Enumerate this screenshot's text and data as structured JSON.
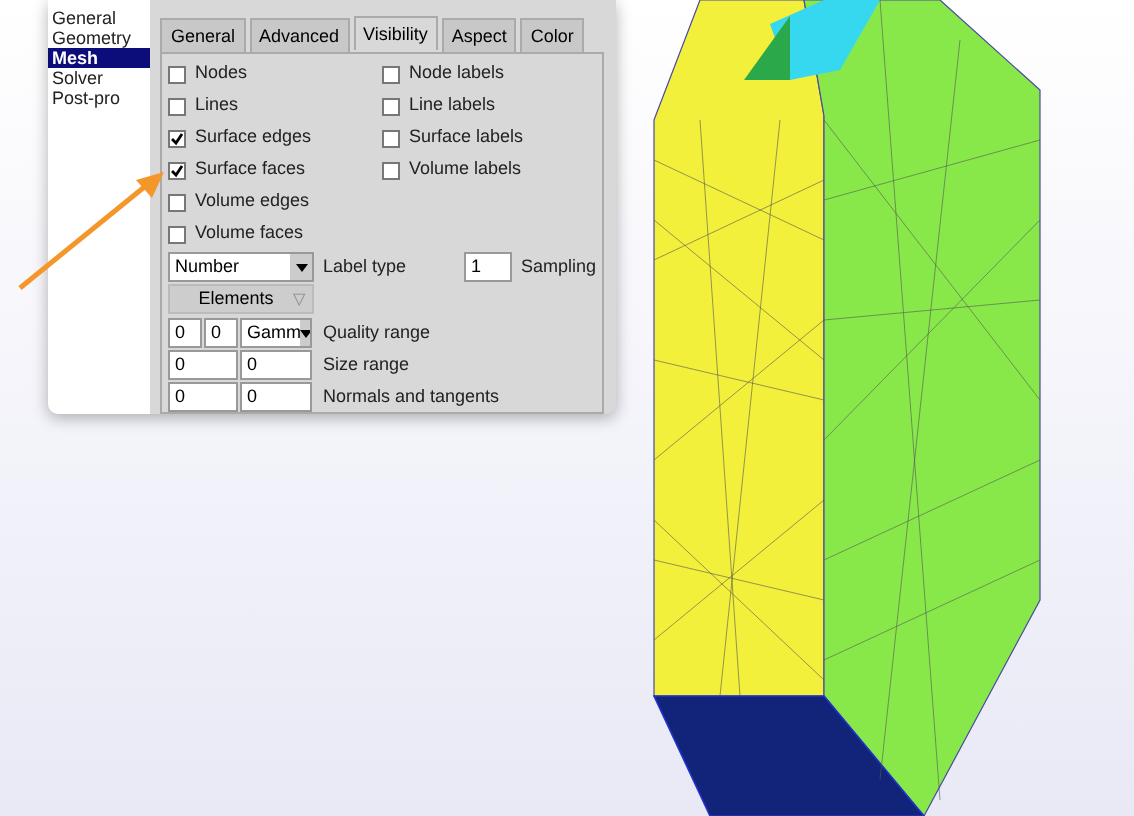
{
  "sidebar": {
    "items": [
      {
        "label": "General",
        "selected": false
      },
      {
        "label": "Geometry",
        "selected": false
      },
      {
        "label": "Mesh",
        "selected": true
      },
      {
        "label": "Solver",
        "selected": false
      },
      {
        "label": "Post-pro",
        "selected": false
      }
    ]
  },
  "tabs": [
    {
      "label": "General",
      "selected": false
    },
    {
      "label": "Advanced",
      "selected": false
    },
    {
      "label": "Visibility",
      "selected": true
    },
    {
      "label": "Aspect",
      "selected": false
    },
    {
      "label": "Color",
      "selected": false
    }
  ],
  "checkboxes_left": [
    {
      "label": "Nodes",
      "checked": false
    },
    {
      "label": "Lines",
      "checked": false
    },
    {
      "label": "Surface edges",
      "checked": true
    },
    {
      "label": "Surface faces",
      "checked": true
    },
    {
      "label": "Volume edges",
      "checked": false
    },
    {
      "label": "Volume faces",
      "checked": false
    }
  ],
  "checkboxes_right": [
    {
      "label": "Node labels",
      "checked": false
    },
    {
      "label": "Line labels",
      "checked": false
    },
    {
      "label": "Surface labels",
      "checked": false
    },
    {
      "label": "Volume labels",
      "checked": false
    }
  ],
  "label_type": {
    "value": "Number",
    "label": "Label type"
  },
  "sampling": {
    "value": "1",
    "label": "Sampling"
  },
  "elements_button": {
    "label": "Elements",
    "icon": "▽"
  },
  "quality_range": {
    "min": "0",
    "max": "0",
    "measure": "Gamm",
    "label": "Quality range"
  },
  "size_range": {
    "min": "0",
    "max": "0",
    "label": "Size range"
  },
  "normals_tangents": {
    "normals": "0",
    "tangents": "0",
    "label": "Normals and tangents"
  }
}
